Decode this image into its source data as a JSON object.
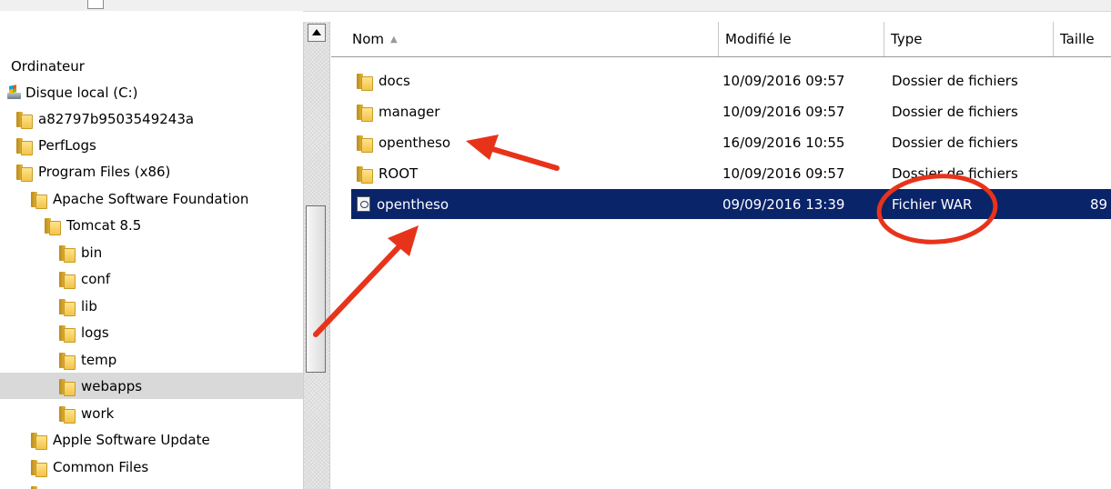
{
  "nav": {
    "items": [
      {
        "label": "Ordinateur",
        "icon": "computer",
        "indent": 12
      },
      {
        "label": "Disque local (C:)",
        "icon": "drive-icon",
        "indent": 8
      },
      {
        "label": "a82797b9503549243a",
        "icon": "folder-icon",
        "indent": 18
      },
      {
        "label": "PerfLogs",
        "icon": "folder-icon",
        "indent": 18
      },
      {
        "label": "Program Files (x86)",
        "icon": "folder-icon",
        "indent": 18
      },
      {
        "label": "Apache Software Foundation",
        "icon": "folder-icon",
        "indent": 34
      },
      {
        "label": "Tomcat 8.5",
        "icon": "folder-icon",
        "indent": 49
      },
      {
        "label": "bin",
        "icon": "folder-icon",
        "indent": 65
      },
      {
        "label": "conf",
        "icon": "folder-icon",
        "indent": 65
      },
      {
        "label": "lib",
        "icon": "folder-icon",
        "indent": 65
      },
      {
        "label": "logs",
        "icon": "folder-icon",
        "indent": 65
      },
      {
        "label": "temp",
        "icon": "folder-icon",
        "indent": 65
      },
      {
        "label": "webapps",
        "icon": "folder-icon",
        "indent": 65
      },
      {
        "label": "work",
        "icon": "folder-icon",
        "indent": 65
      },
      {
        "label": "Apple Software Update",
        "icon": "folder-icon",
        "indent": 34
      },
      {
        "label": "Common Files",
        "icon": "folder-icon",
        "indent": 34
      },
      {
        "label": "",
        "icon": "folder-icon",
        "indent": 34
      }
    ],
    "selected_index": 12
  },
  "columns": {
    "name": "Nom",
    "modified": "Modifié le",
    "type": "Type",
    "size": "Taille"
  },
  "files": [
    {
      "name": "docs",
      "modified": "10/09/2016 09:57",
      "type": "Dossier de fichiers",
      "size": "",
      "icon": "folder-icon"
    },
    {
      "name": "manager",
      "modified": "10/09/2016 09:57",
      "type": "Dossier de fichiers",
      "size": "",
      "icon": "folder-icon"
    },
    {
      "name": "opentheso",
      "modified": "16/09/2016 10:55",
      "type": "Dossier de fichiers",
      "size": "",
      "icon": "folder-icon"
    },
    {
      "name": "ROOT",
      "modified": "10/09/2016 09:57",
      "type": "Dossier de fichiers",
      "size": "",
      "icon": "folder-icon"
    },
    {
      "name": "opentheso",
      "modified": "09/09/2016 13:39",
      "type": "Fichier WAR",
      "size": "89",
      "icon": "war-file-icon"
    }
  ],
  "selected_file_index": 4,
  "colors": {
    "selection": "#0a246a",
    "nav_selection": "#d9d9d9",
    "annotation": "#e8331b"
  }
}
